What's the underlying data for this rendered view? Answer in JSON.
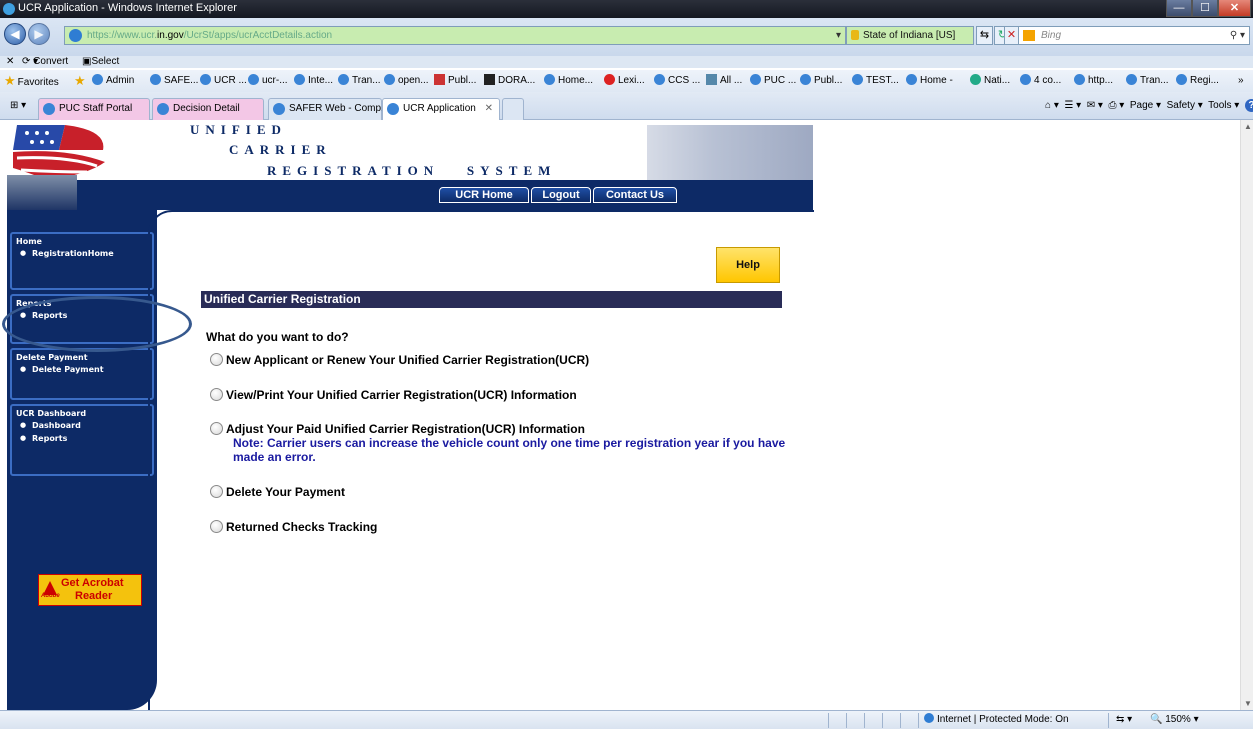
{
  "window": {
    "title": "UCR Application - Windows Internet Explorer"
  },
  "address": {
    "url_prefix": "https://www.ucr.",
    "url_domain": "in.gov",
    "url_path": "/UcrSt/apps/ucrAcctDetails.action",
    "cert_label": "State of Indiana [US]",
    "search_placeholder": "Bing"
  },
  "commandbar": {
    "convert": "Convert",
    "select": "Select"
  },
  "favorites": {
    "label": "Favorites",
    "items": [
      "Admin",
      "SAFE...",
      "UCR ...",
      "ucr-...",
      "Inte...",
      "Tran...",
      "open...",
      "Publ...",
      "DORA...",
      "Home...",
      "Lexi...",
      "CCS ...",
      "All ...",
      "PUC ...",
      "Publ...",
      "TEST...",
      "Home -",
      "Nati...",
      "4 co...",
      "http...",
      "Tran...",
      "Regi..."
    ]
  },
  "tabs": [
    {
      "label": "PUC Staff Portal"
    },
    {
      "label": "Decision Detail"
    },
    {
      "label": "SAFER Web - Comp..."
    },
    {
      "label": "UCR Application"
    }
  ],
  "tabtools": {
    "page": "Page",
    "safety": "Safety",
    "tools": "Tools"
  },
  "header": {
    "line1": "UNIFIED",
    "line2": "CARRIER",
    "line3": "REGISTRATION   SYSTEM",
    "nav": {
      "home": "UCR Home",
      "logout": "Logout",
      "contact": "Contact Us"
    }
  },
  "sidebar": {
    "home": {
      "head": "Home",
      "items": [
        "RegistrationHome"
      ]
    },
    "reports": {
      "head": "Reports",
      "items": [
        "Reports"
      ]
    },
    "delete": {
      "head": "Delete Payment",
      "items": [
        "Delete Payment"
      ]
    },
    "dashboard": {
      "head": "UCR Dashboard",
      "items": [
        "Dashboard",
        "Reports"
      ]
    },
    "acrobat": {
      "line1": "Get Acrobat",
      "line2": "Reader",
      "brand": "Adobe"
    }
  },
  "main": {
    "help": "Help",
    "section_title": "Unified Carrier Registration",
    "question": "What do you want to do?",
    "options": [
      "New Applicant or Renew Your Unified Carrier Registration(UCR)",
      "View/Print Your Unified Carrier Registration(UCR) Information",
      "Adjust Your Paid Unified Carrier Registration(UCR) Information",
      "Delete Your Payment",
      "Returned Checks Tracking"
    ],
    "note": "Note: Carrier users can increase the vehicle count only one time per registration year if you have made an error."
  },
  "statusbar": {
    "zone": "Internet | Protected Mode: On",
    "zoom": "150%"
  }
}
